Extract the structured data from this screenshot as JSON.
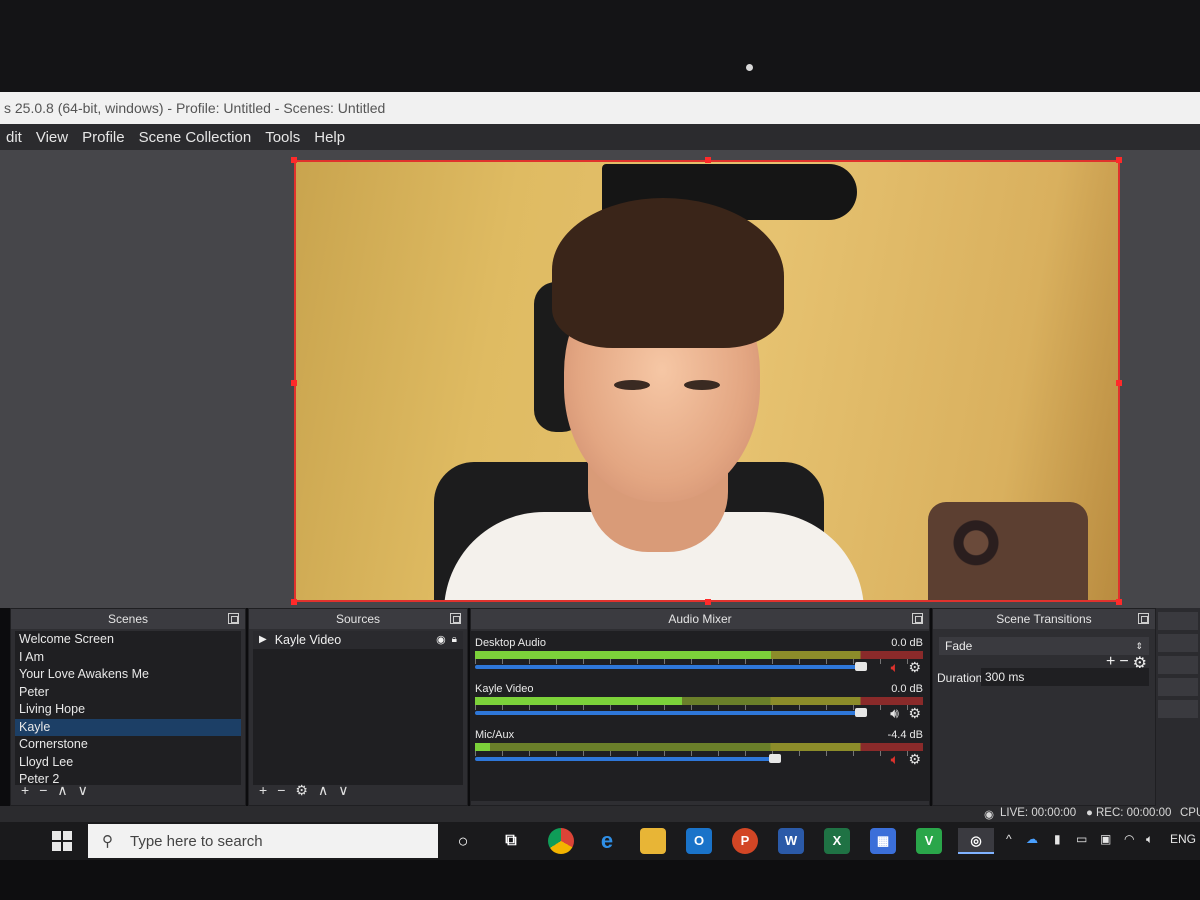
{
  "window": {
    "title": "s 25.0.8 (64-bit, windows) - Profile: Untitled - Scenes: Untitled"
  },
  "menu": [
    "dit",
    "View",
    "Profile",
    "Scene Collection",
    "Tools",
    "Help"
  ],
  "docks": {
    "scenes": {
      "title": "Scenes",
      "items": [
        "Welcome Screen",
        "I Am",
        "Your Love Awakens Me",
        "Peter",
        "Living Hope",
        "Kayle",
        "Cornerstone",
        "Lloyd Lee",
        "Peter 2"
      ],
      "selected_index": 5,
      "toolbar": [
        "+",
        "−",
        "∧",
        "∨"
      ]
    },
    "sources": {
      "title": "Sources",
      "items": [
        {
          "name": "Kayle Video"
        }
      ],
      "toolbar": [
        "+",
        "−",
        "⚙",
        "∧",
        "∨"
      ]
    },
    "mixer": {
      "title": "Audio Mixer",
      "channels": [
        {
          "name": "Desktop Audio",
          "db": "0.0 dB",
          "level": 1.0,
          "volume": 1.0,
          "muted": true
        },
        {
          "name": "Kayle Video",
          "db": "0.0 dB",
          "level": 0.7,
          "volume": 1.0,
          "muted": false
        },
        {
          "name": "Mic/Aux",
          "db": "-4.4 dB",
          "level": 0.05,
          "volume": 0.78,
          "muted": true
        }
      ]
    },
    "transitions": {
      "title": "Scene Transitions",
      "selected": "Fade",
      "duration_label": "Duration",
      "duration_value": "300 ms"
    }
  },
  "status": {
    "live": "LIVE: 00:00:00",
    "rec": "REC: 00:00:00",
    "cpu": "CPU"
  },
  "taskbar": {
    "search_placeholder": "Type here to search",
    "apps": [
      "task-view",
      "chrome",
      "edge",
      "file-explorer",
      "outlook",
      "powerpoint",
      "word",
      "excel",
      "calendar",
      "vim",
      "obs"
    ],
    "language": "ENG"
  },
  "colors": {
    "selection": "#ff2a2a",
    "accent_blue": "#2e77d9",
    "meter_green": "#7cd13a",
    "mute_red": "#e0322d"
  }
}
